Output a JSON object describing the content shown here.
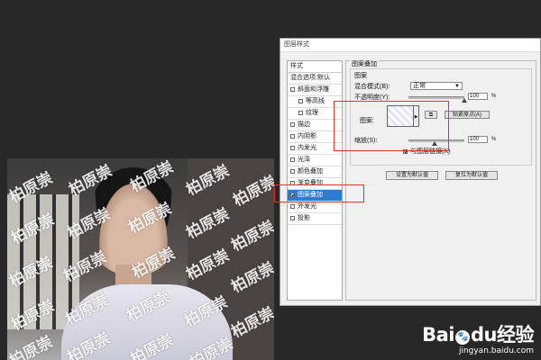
{
  "dialog": {
    "title": "图层样式",
    "left_panel": {
      "header": "样式",
      "blend_default": "混合选项:默认",
      "items": [
        {
          "label": "斜面和浮雕",
          "checked": false,
          "sub": false
        },
        {
          "label": "等高线",
          "checked": false,
          "sub": true
        },
        {
          "label": "纹理",
          "checked": false,
          "sub": true
        },
        {
          "label": "描边",
          "checked": false,
          "sub": false
        },
        {
          "label": "内阴影",
          "checked": false,
          "sub": false
        },
        {
          "label": "内发光",
          "checked": false,
          "sub": false
        },
        {
          "label": "光泽",
          "checked": false,
          "sub": false
        },
        {
          "label": "颜色叠加",
          "checked": false,
          "sub": false
        },
        {
          "label": "渐变叠加",
          "checked": false,
          "sub": false
        },
        {
          "label": "图案叠加",
          "checked": true,
          "sub": false,
          "selected": true
        },
        {
          "label": "外发光",
          "checked": false,
          "sub": false
        },
        {
          "label": "投影",
          "checked": false,
          "sub": false
        }
      ]
    },
    "pattern_overlay": {
      "section_title": "图案叠加",
      "group_title": "图案",
      "blend_mode_label": "混合模式(B):",
      "blend_mode_value": "正常",
      "opacity_label": "不透明度(Y):",
      "opacity_value": "100",
      "pattern_label": "图案:",
      "new_preset_button": "⧉",
      "snap_origin_button": "贴紧原点(A)",
      "scale_label": "缩放(S):",
      "scale_value": "100",
      "percent": "%",
      "link_layer_label": "与图层链接(K)",
      "link_layer_checked": true,
      "make_default_button": "设置为默认值",
      "reset_default_button": "复位为默认值"
    }
  },
  "watermark_text": "柏原崇",
  "baidu": {
    "logo_prefix": "Bai",
    "logo_paw": "du",
    "logo_suffix": "经验",
    "site": "jingyan.baidu.com"
  },
  "colors": {
    "selection": "#2b7bd4",
    "highlight": "#e8302a"
  }
}
